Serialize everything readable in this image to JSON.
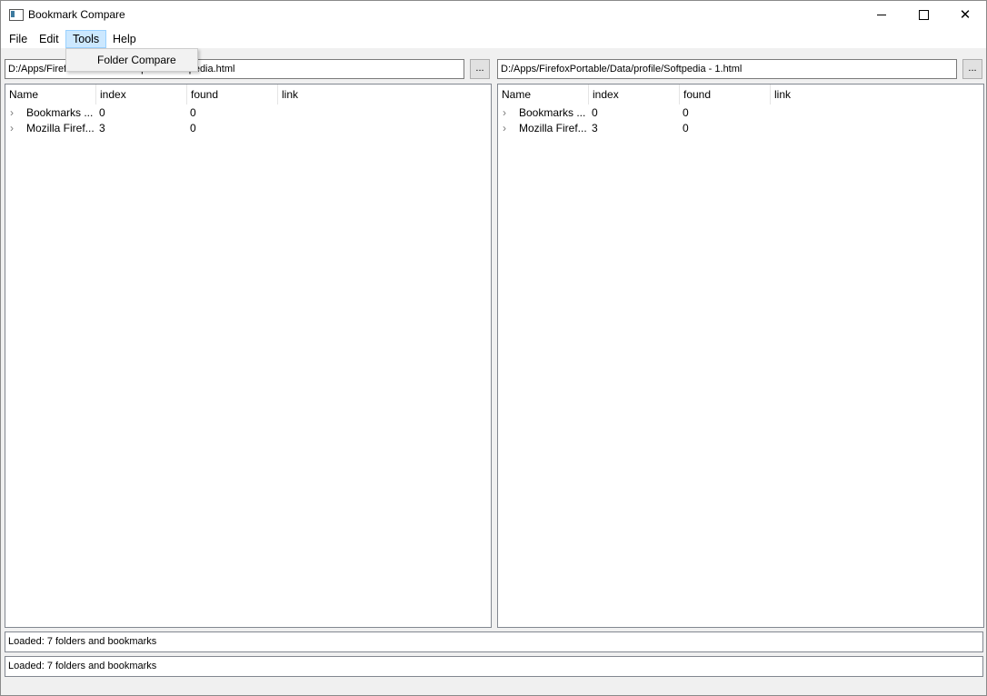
{
  "window": {
    "title": "Bookmark Compare",
    "minimize": "—",
    "close": "✕"
  },
  "menubar": {
    "file": "File",
    "edit": "Edit",
    "tools": "Tools",
    "help": "Help"
  },
  "tools_menu": {
    "folder_compare": "Folder Compare"
  },
  "left": {
    "path": "D:/Apps/FirefoxPortable/Data/profile/Softpedia.html",
    "browse_label": "...",
    "columns": [
      "Name",
      "index",
      "found",
      "link"
    ],
    "rows": [
      {
        "name": "Bookmarks ...",
        "index": "0",
        "found": "0",
        "link": ""
      },
      {
        "name": "Mozilla Firef...",
        "index": "3",
        "found": "0",
        "link": ""
      }
    ]
  },
  "right": {
    "path": "D:/Apps/FirefoxPortable/Data/profile/Softpedia - 1.html",
    "browse_label": "...",
    "columns": [
      "Name",
      "index",
      "found",
      "link"
    ],
    "rows": [
      {
        "name": "Bookmarks ...",
        "index": "0",
        "found": "0",
        "link": ""
      },
      {
        "name": "Mozilla Firef...",
        "index": "3",
        "found": "0",
        "link": ""
      }
    ]
  },
  "status": {
    "line1": "Loaded: 7 folders and bookmarks",
    "line2": "Loaded: 7 folders and bookmarks"
  },
  "icons": {
    "expand": "chevron-right-icon",
    "app": "app-icon"
  }
}
